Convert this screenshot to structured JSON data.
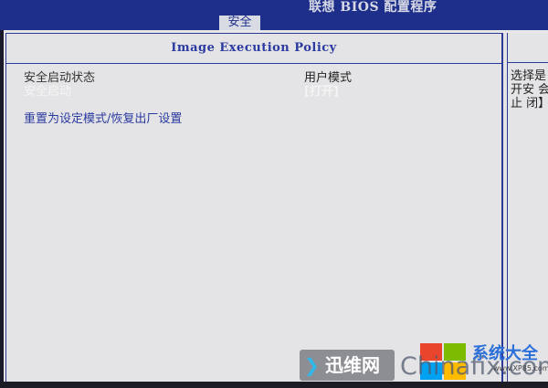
{
  "header": {
    "bios_title": "联想 BIOS 配置程序",
    "active_tab": "安全"
  },
  "main": {
    "panel_title": "Image Execution Policy",
    "rows": [
      {
        "label": "安全启动状态",
        "value": "用户模式"
      },
      {
        "label": "安全启动",
        "value": "[打开]"
      },
      {
        "label": "重置为设定模式/恢复出厂设置",
        "value": ""
      }
    ]
  },
  "help": {
    "text": "选择是 打开安 会阻止 闭】关"
  },
  "watermark": {
    "left_text": "迅维网",
    "right_text": "Chinafix.com",
    "brand": "系统大全",
    "url": "www.XP85.com"
  },
  "colors": {
    "header_bg": "#1d2f8a",
    "accent": "#2a3aa0",
    "panel_bg": "#e4e4e6"
  }
}
